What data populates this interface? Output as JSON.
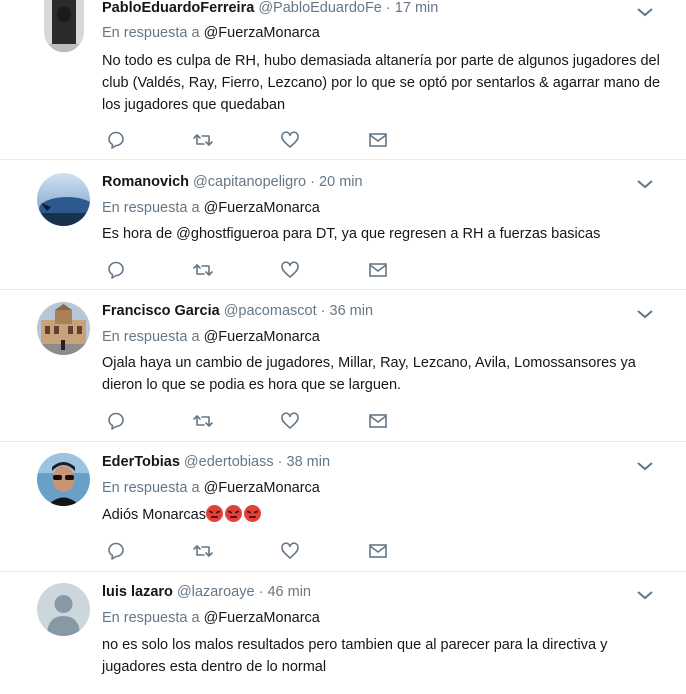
{
  "tweets": [
    {
      "fullname": "PabloEduardoFerreira",
      "username": "@PabloEduardoFe",
      "dot": "·",
      "time": "17 min",
      "reply_prefix": "En respuesta a",
      "reply_to": "@FuerzaMonarca",
      "text": "No todo es culpa de RH, hubo demasiada altanería por parte de algunos jugadores del club (Valdés, Ray, Fierro, Lezcano) por lo que se optó por sentarlos & agarrar mano de los jugadores que quedaban"
    },
    {
      "fullname": "Romanovich",
      "username": "@capitanopeligro",
      "dot": "·",
      "time": "20 min",
      "reply_prefix": "En respuesta a",
      "reply_to": "@FuerzaMonarca",
      "text": "Es hora de @ghostfigueroa para DT, ya que regresen a RH a fuerzas basicas"
    },
    {
      "fullname": "Francisco Garcia",
      "username": "@pacomascot",
      "dot": "·",
      "time": "36 min",
      "reply_prefix": "En respuesta a",
      "reply_to": "@FuerzaMonarca",
      "text": "Ojala haya un cambio de jugadores, Millar, Ray, Lezcano, Avila, Lomossansores ya dieron lo que se podia es hora que se larguen."
    },
    {
      "fullname": "EderTobias",
      "username": "@edertobiass",
      "dot": "·",
      "time": "38 min",
      "reply_prefix": "En respuesta a",
      "reply_to": "@FuerzaMonarca",
      "text": "Adiós Monarcas"
    },
    {
      "fullname": "luis lazaro",
      "username": "@lazaroaye",
      "dot": "·",
      "time": "46 min",
      "reply_prefix": "En respuesta a",
      "reply_to": "@FuerzaMonarca",
      "text": "no es solo los malos resultados pero tambien que al parecer  para la directiva y jugadores esta dentro de lo normal"
    }
  ],
  "icons": {
    "reply": "reply-icon",
    "retweet": "retweet-icon",
    "like": "heart-icon",
    "dm": "envelope-icon",
    "caret": "chevron-down-icon"
  },
  "colors": {
    "secondary_text": "#657786",
    "icon": "#657786",
    "divider": "#e6ecf0",
    "angry_emoji": "#e0423a"
  }
}
